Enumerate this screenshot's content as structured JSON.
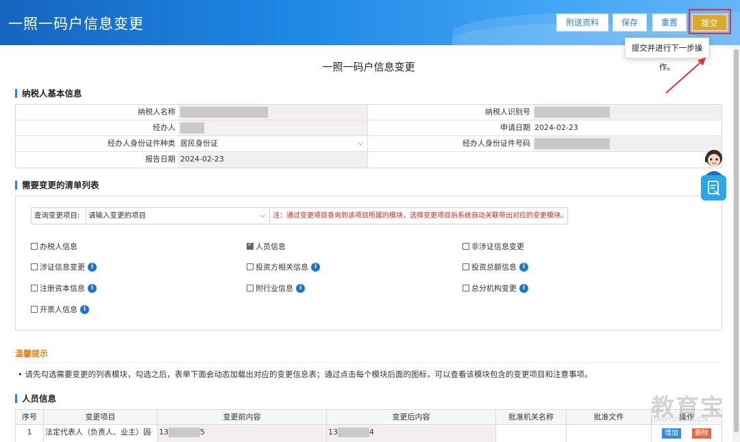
{
  "header": {
    "title": "一照一码户信息变更",
    "buttons": {
      "attach": "附送资料",
      "save": "保存",
      "reset": "重置",
      "submit": "提交"
    },
    "tooltip": "提交并进行下一步操作。"
  },
  "page_title": "一照一码户信息变更",
  "basic": {
    "section": "纳税人基本信息",
    "taxpayer_name_label": "纳税人名称",
    "taxpayer_id_label": "纳税人识别号",
    "agent_label": "经办人",
    "apply_date_label": "申请日期",
    "apply_date": "2024-02-23",
    "id_type_label": "经办人身份证件种类",
    "id_type": "居民身份证",
    "id_no_label": "经办人身份证件号码",
    "report_date_label": "报告日期",
    "report_date": "2024-02-23"
  },
  "change_list": {
    "section": "需要变更的清单列表",
    "query_label": "查询变更项目:",
    "query_placeholder": "请输入变更的项目",
    "query_note": "注：通过变更项目查询到该项目所属的模块，选择变更项目后系统自动关联带出对应的变更模块。",
    "items": [
      {
        "label": "办税人信息",
        "checked": false,
        "info": false
      },
      {
        "label": "人员信息",
        "checked": true,
        "info": false
      },
      {
        "label": "非涉证信息变更",
        "checked": false,
        "info": false
      },
      {
        "label": "涉证信息变更",
        "checked": false,
        "info": true
      },
      {
        "label": "投资方相关信息",
        "checked": false,
        "info": true
      },
      {
        "label": "投资总额信息",
        "checked": false,
        "info": true
      },
      {
        "label": "注册资本信息",
        "checked": false,
        "info": true
      },
      {
        "label": "附行业信息",
        "checked": false,
        "info": true
      },
      {
        "label": "总分机构变更",
        "checked": false,
        "info": true
      },
      {
        "label": "开票人信息",
        "checked": false,
        "info": true
      }
    ]
  },
  "tips": {
    "title": "温馨提示",
    "text": "请先勾选需要变更的列表模块，勾选之后，表单下面会动态加载出对应的变更信息表；通过点击每个模块后面的图标，可以查看该模块包含的变更项目和注意事项。"
  },
  "personnel": {
    "section": "人员信息",
    "columns": [
      "序号",
      "变更项目",
      "变更前内容",
      "变更后内容",
      "批准机关名称",
      "批准文件",
      "操作"
    ],
    "rows": [
      {
        "no": "1",
        "item": "法定代表人（负责人、业主）固",
        "before_prefix": "13",
        "before_suffix": "5",
        "after_prefix": "13",
        "after_suffix": "4"
      }
    ],
    "add_label": "增加",
    "delete_label": "删除"
  },
  "watermark": {
    "brand": "教育宝",
    "url": "JIAOYUBAO.CN"
  }
}
